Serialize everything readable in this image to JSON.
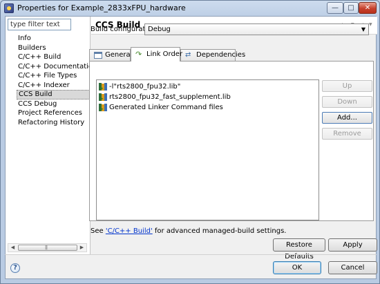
{
  "window": {
    "title": "Properties for Example_2833xFPU_hardware"
  },
  "filter": {
    "placeholder": "type filter text"
  },
  "nav": {
    "items": [
      {
        "label": "Info"
      },
      {
        "label": "Builders"
      },
      {
        "label": "C/C++ Build"
      },
      {
        "label": "C/C++ Documentation"
      },
      {
        "label": "C/C++ File Types"
      },
      {
        "label": "C/C++ Indexer"
      },
      {
        "label": "CCS Build",
        "selected": true
      },
      {
        "label": "CCS Debug"
      },
      {
        "label": "Project References"
      },
      {
        "label": "Refactoring History"
      }
    ]
  },
  "page": {
    "title": "CCS Build"
  },
  "build_config": {
    "label": "Build configuration:",
    "value": "Debug"
  },
  "tabs": [
    {
      "label": "General",
      "icon": "general-tab-icon"
    },
    {
      "label": "Link Order",
      "icon": "link-order-icon",
      "active": true
    },
    {
      "label": "Dependencies",
      "icon": "dependencies-icon"
    }
  ],
  "link_order": {
    "items": [
      "-l\"rts2800_fpu32.lib\"",
      "rts2800_fpu32_fast_supplement.lib",
      "Generated Linker Command files"
    ]
  },
  "side_buttons": {
    "up": "Up",
    "down": "Down",
    "add": "Add...",
    "remove": "Remove"
  },
  "footer": {
    "see": "See ",
    "link": "'C/C++ Build'",
    "rest": " for advanced managed-build settings."
  },
  "buttons": {
    "restore": "Restore Defaults",
    "apply": "Apply",
    "ok": "OK",
    "cancel": "Cancel"
  },
  "icons": {
    "help": "?"
  }
}
